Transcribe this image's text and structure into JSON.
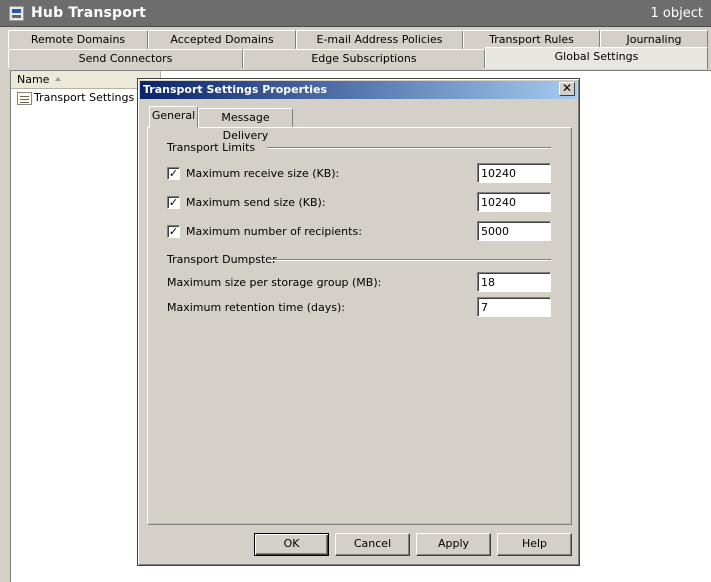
{
  "header": {
    "title": "Hub Transport",
    "count": "1 object",
    "icon": "hub-transport-icon"
  },
  "tabs_row1": [
    {
      "label": "Remote Domains"
    },
    {
      "label": "Accepted Domains"
    },
    {
      "label": "E-mail Address Policies"
    },
    {
      "label": "Transport Rules"
    },
    {
      "label": "Journaling"
    }
  ],
  "tabs_row2": [
    {
      "label": "Send Connectors"
    },
    {
      "label": "Edge Subscriptions"
    },
    {
      "label": "Global Settings",
      "active": true
    }
  ],
  "list": {
    "column_header": "Name",
    "items": [
      {
        "label": "Transport Settings",
        "icon": "transport-settings-icon"
      }
    ]
  },
  "dialog": {
    "title": "Transport Settings Properties",
    "close_glyph": "✕",
    "tabs": [
      {
        "label": "General",
        "active": true
      },
      {
        "label": "Message Delivery"
      }
    ],
    "sections": {
      "limits_title": "Transport Limits",
      "dumpster_title": "Transport Dumpster"
    },
    "fields": {
      "max_receive": {
        "label": "Maximum receive size (KB):",
        "value": "10240",
        "checked": true
      },
      "max_send": {
        "label": "Maximum send size (KB):",
        "value": "10240",
        "checked": true
      },
      "max_recipients": {
        "label": "Maximum number of recipients:",
        "value": "5000",
        "checked": true
      },
      "max_per_storage_group": {
        "label": "Maximum size per storage group (MB):",
        "value": "18"
      },
      "max_retention": {
        "label": "Maximum retention time (days):",
        "value": "7"
      }
    },
    "check_glyph": "✓",
    "buttons": {
      "ok": "OK",
      "cancel": "Cancel",
      "apply": "Apply",
      "help": "Help"
    }
  },
  "colors": {
    "title_bar_start": "#0a246a",
    "title_bar_end": "#a6caf0",
    "header_bg": "#6d6d6d",
    "window_bg": "#d4d0c8"
  }
}
